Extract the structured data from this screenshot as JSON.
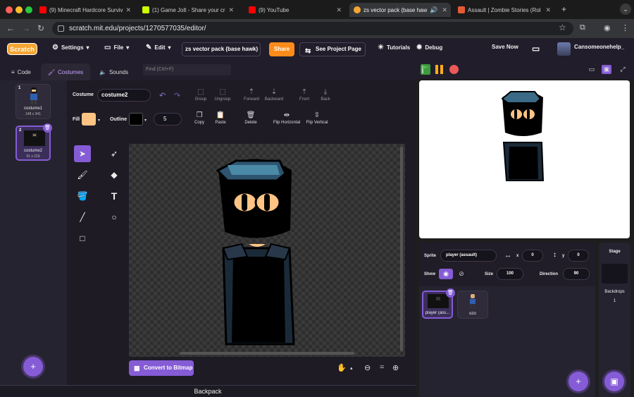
{
  "browser": {
    "tabs": [
      {
        "title": "(9) Minecraft Hardcore Surviv",
        "favicon": "youtube-icon",
        "color": "#ff0000"
      },
      {
        "title": "(1) Game Jolt - Share your cr",
        "favicon": "gamejolt-icon",
        "color": "#ccff00"
      },
      {
        "title": "(9) YouTube",
        "favicon": "youtube-icon",
        "color": "#ff0000"
      },
      {
        "title": "zs vector pack (base haw",
        "favicon": "scratch-icon",
        "color": "#f7a531"
      },
      {
        "title": "Assault | Zombie Stories (Rol",
        "favicon": "fandom-icon",
        "color": "#e25b33"
      }
    ],
    "url": "scratch.mit.edu/projects/1270577035/editor/"
  },
  "menubar": {
    "logo": "Scratch",
    "settings": "Settings",
    "file": "File",
    "edit": "Edit",
    "project_title": "zs vector pack (base hawk)",
    "share": "Share",
    "see_project_page": "See Project Page",
    "tutorials": "Tutorials",
    "debug": "Debug",
    "save_now": "Save Now",
    "username": "Cansomeonehelp_"
  },
  "editor_tabs": {
    "code": "Code",
    "costumes": "Costumes",
    "sounds": "Sounds",
    "find_placeholder": "Find (Ctrl+F)"
  },
  "costumes": [
    {
      "num": "1",
      "name": "costume1",
      "size": "148 x 341"
    },
    {
      "num": "2",
      "name": "costume2",
      "size": "91 x 219"
    }
  ],
  "paint": {
    "costume_label": "Costume",
    "costume_name": "costume2",
    "tools_row1": [
      "Group",
      "Ungroup",
      "Forward",
      "Backward",
      "Front",
      "Back"
    ],
    "tools_row2": [
      "Copy",
      "Paste",
      "Delete",
      "Flip Horizontal",
      "Flip Vertical"
    ],
    "fill_label": "Fill",
    "outline_label": "Outline",
    "outline_width": "5",
    "fill_color": "#ffc484",
    "convert_button": "Convert to Bitmap"
  },
  "sprite_info": {
    "sprite_label": "Sprite",
    "sprite_name": "player (assault)",
    "x_label": "x",
    "x": "0",
    "y_label": "y",
    "y": "0",
    "show_label": "Show",
    "size_label": "Size",
    "size": "100",
    "direction_label": "Direction",
    "direction": "90"
  },
  "sprites": [
    {
      "name": "player (ass..."
    },
    {
      "name": "ozo"
    }
  ],
  "stage_panel": {
    "title": "Stage",
    "backdrops_label": "Backdrops",
    "backdrops_count": "1"
  },
  "backpack": "Backpack"
}
